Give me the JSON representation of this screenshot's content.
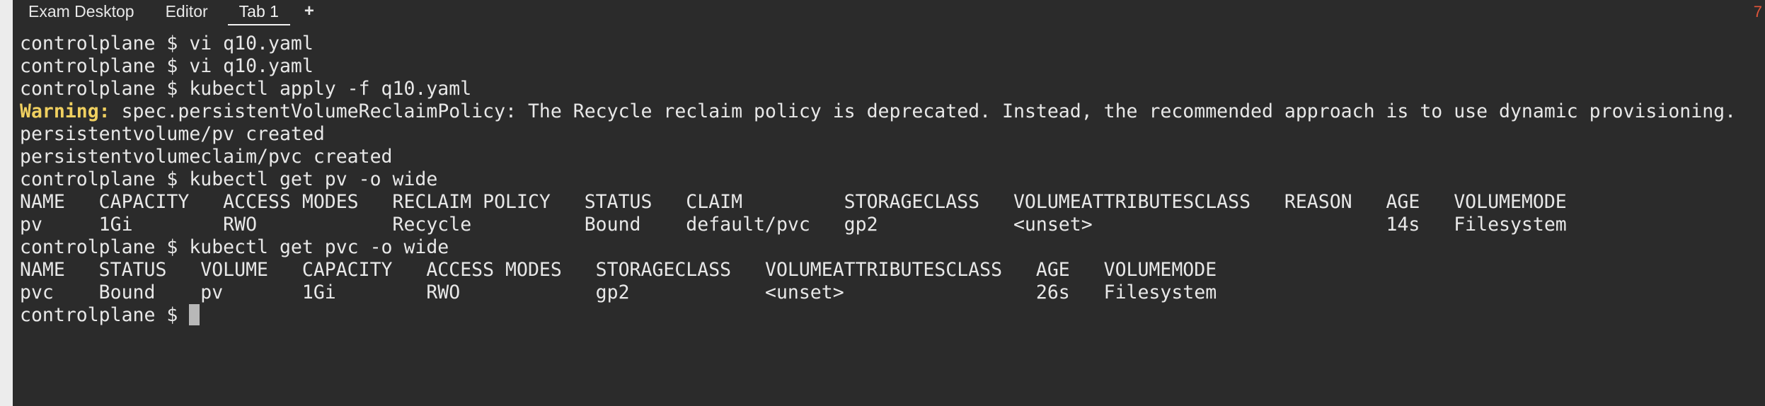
{
  "tabs": [
    {
      "label": "Exam Desktop",
      "active": false
    },
    {
      "label": "Editor",
      "active": false
    },
    {
      "label": "Tab 1",
      "active": true
    }
  ],
  "add_tab_label": "+",
  "corner_badge": "7",
  "terminal": {
    "lines": [
      "controlplane $ vi q10.yaml",
      "controlplane $ vi q10.yaml",
      "controlplane $ kubectl apply -f q10.yaml"
    ],
    "warning_label": "Warning:",
    "warning_text": " spec.persistentVolumeReclaimPolicy: The Recycle reclaim policy is deprecated. Instead, the recommended approach is to use dynamic provisioning.",
    "lines_after_warning": [
      "persistentvolume/pv created",
      "persistentvolumeclaim/pvc created",
      "controlplane $ kubectl get pv -o wide",
      "NAME   CAPACITY   ACCESS MODES   RECLAIM POLICY   STATUS   CLAIM         STORAGECLASS   VOLUMEATTRIBUTESCLASS   REASON   AGE   VOLUMEMODE",
      "pv     1Gi        RWO            Recycle          Bound    default/pvc   gp2            <unset>                          14s   Filesystem",
      "controlplane $ kubectl get pvc -o wide",
      "NAME   STATUS   VOLUME   CAPACITY   ACCESS MODES   STORAGECLASS   VOLUMEATTRIBUTESCLASS   AGE   VOLUMEMODE",
      "pvc    Bound    pv       1Gi        RWO            gp2            <unset>                 26s   Filesystem"
    ],
    "prompt": "controlplane $ "
  }
}
